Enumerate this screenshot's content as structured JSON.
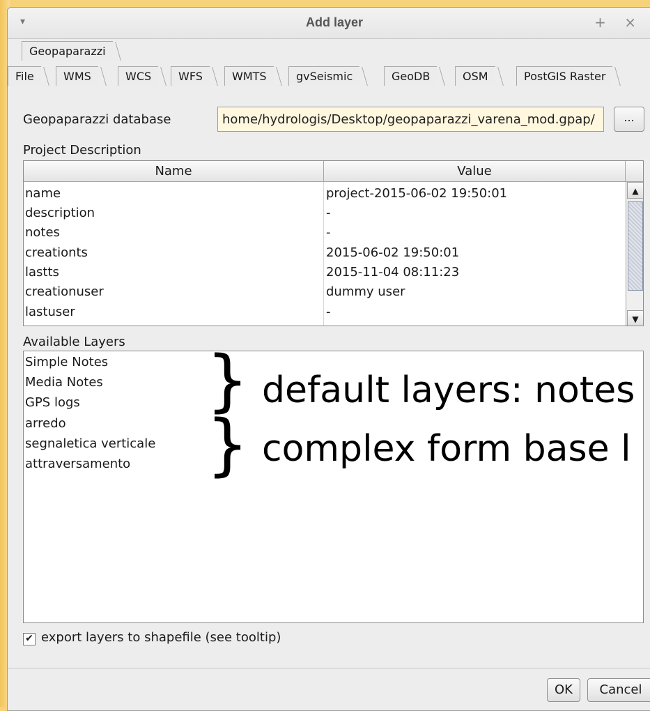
{
  "window": {
    "title": "Add layer",
    "menu_icon": "▾",
    "controls_icon": "+ ×"
  },
  "tabs": {
    "top": [
      "Geopaparazzi"
    ],
    "row": [
      "File",
      "WMS",
      "WCS",
      "WFS",
      "WMTS",
      "gvSeismic",
      "GeoDB",
      "OSM",
      "PostGIS Raster"
    ]
  },
  "database": {
    "label": "Geopaparazzi database",
    "value": "/home/hydrologis/Desktop/geopaparazzi_varena_mod.gpap",
    "browse_label": "..."
  },
  "project": {
    "section_label": "Project Description",
    "columns": [
      "Name",
      "Value"
    ],
    "rows": [
      {
        "name": "name",
        "value": "project-2015-06-02 19:50:01"
      },
      {
        "name": "description",
        "value": " -"
      },
      {
        "name": "notes",
        "value": " -"
      },
      {
        "name": "creationts",
        "value": "2015-06-02 19:50:01"
      },
      {
        "name": "lastts",
        "value": "2015-11-04 08:11:23"
      },
      {
        "name": "creationuser",
        "value": "dummy user"
      },
      {
        "name": "lastuser",
        "value": " -"
      }
    ]
  },
  "layers": {
    "section_label": "Available Layers",
    "items": [
      "Simple Notes",
      "Media Notes",
      "GPS logs",
      "arredo",
      "segnaletica verticale",
      "attraversamento"
    ]
  },
  "annotations": {
    "brace": "}",
    "default": "default layers: notes",
    "complex": "complex form base l"
  },
  "export": {
    "checked": true,
    "check_glyph": "✔",
    "label": "export layers to shapefile (see tooltip)"
  },
  "buttons": {
    "ok": "OK",
    "cancel": "Cancel"
  }
}
